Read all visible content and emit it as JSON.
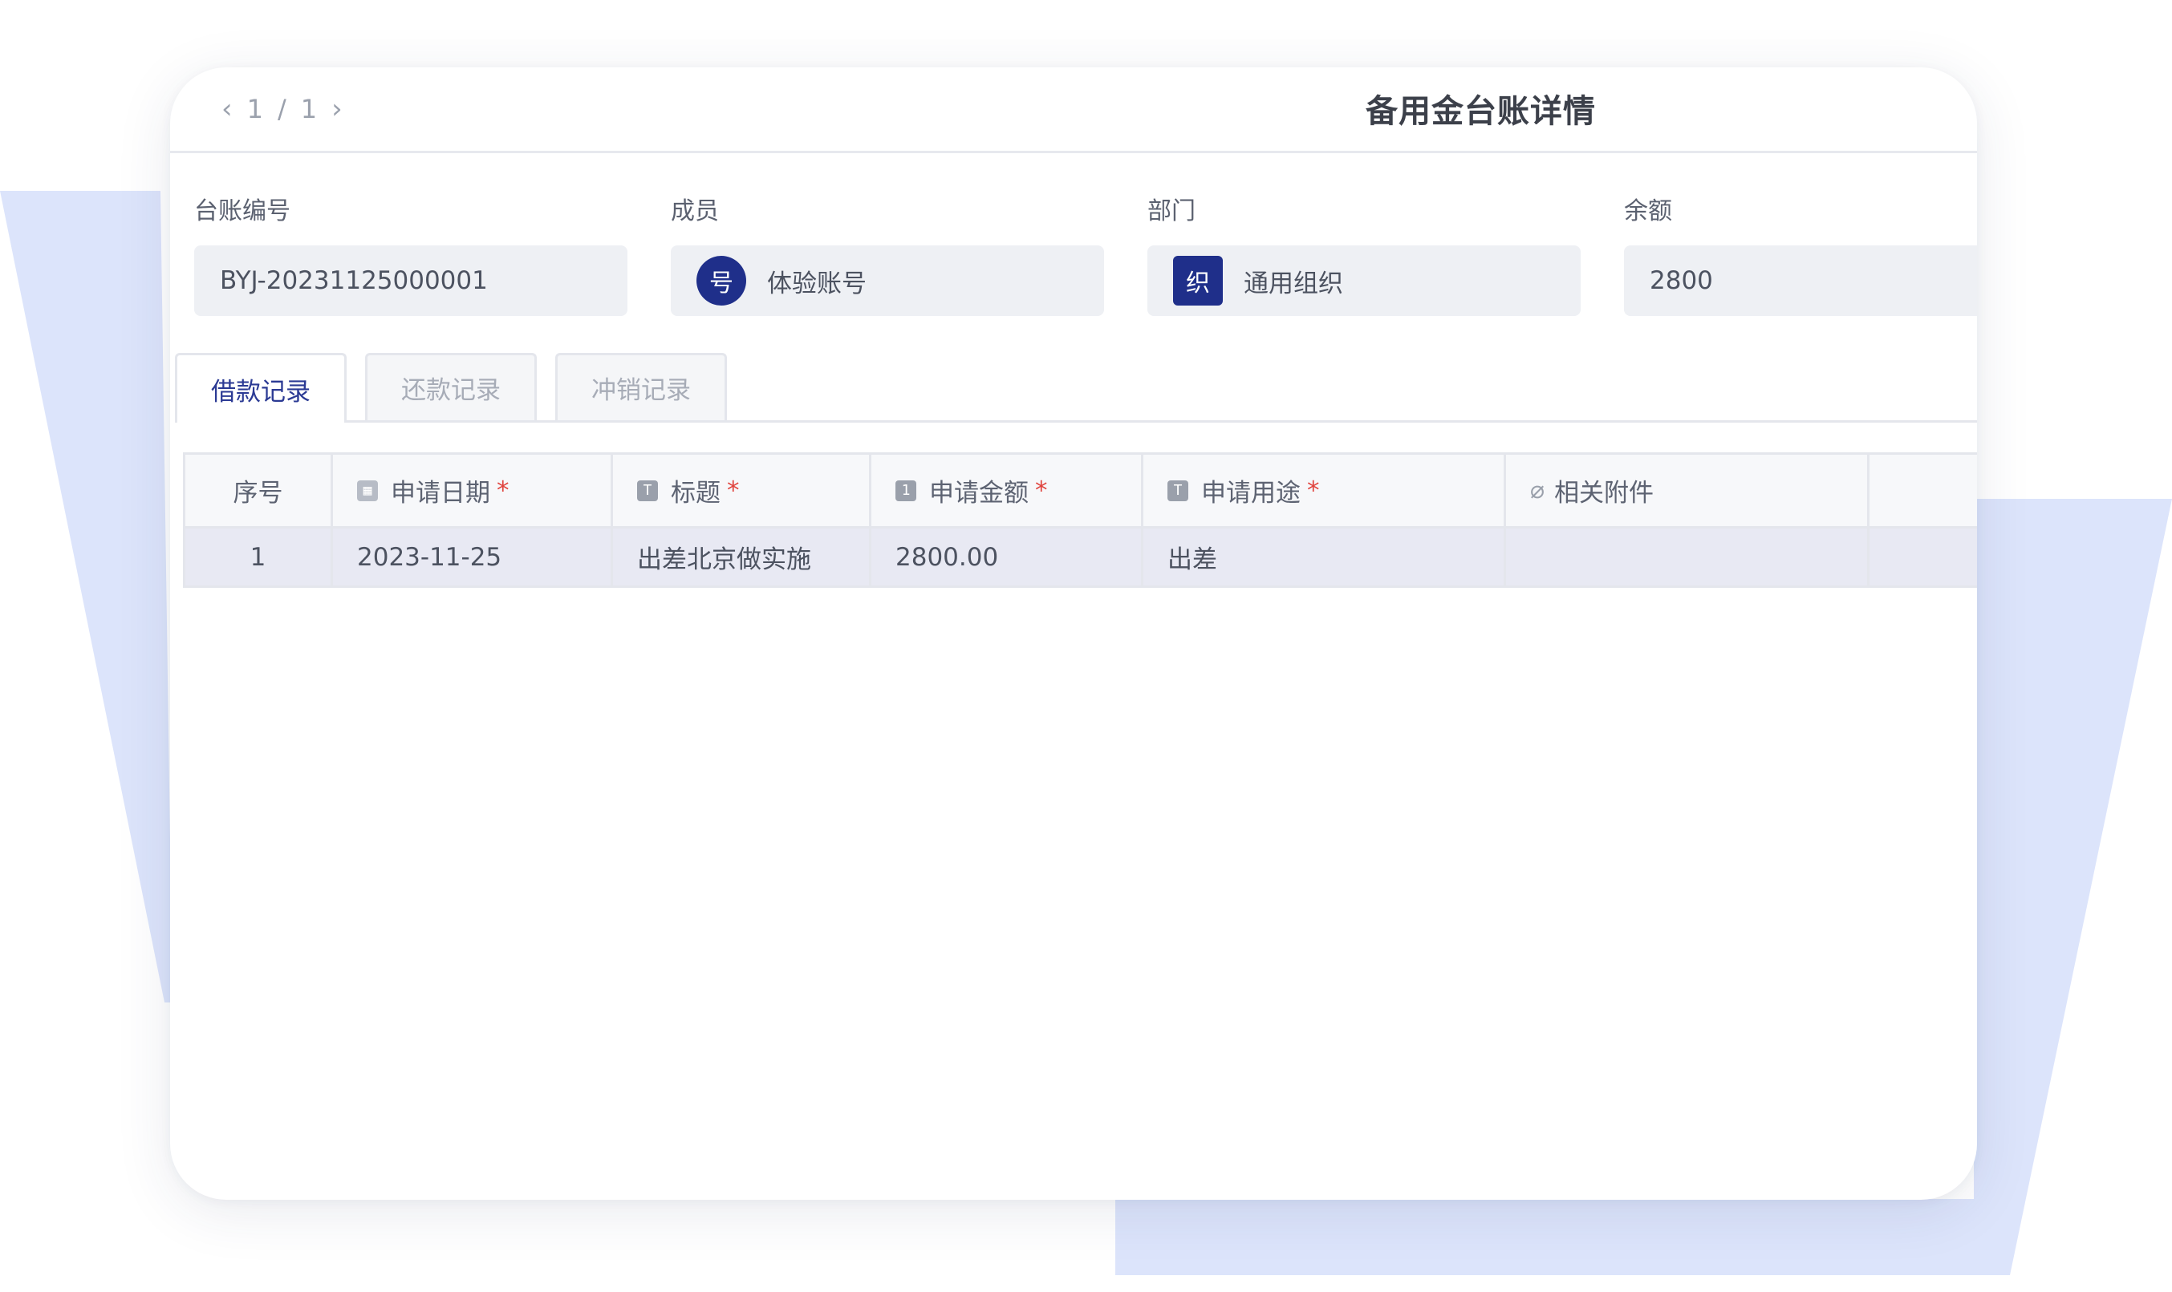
{
  "window": {
    "title": "备用金台账详情",
    "pager": {
      "current": "1",
      "separator": "/",
      "total": "1"
    }
  },
  "fields": [
    {
      "label": "台账编号",
      "value": "BYJ-20231125000001"
    },
    {
      "label": "成员",
      "avatar_text": "号",
      "value": "体验账号"
    },
    {
      "label": "部门",
      "avatar_text": "织",
      "value": "通用组织"
    },
    {
      "label": "余额",
      "value": "2800"
    }
  ],
  "tabs": [
    {
      "label": "借款记录",
      "active": true
    },
    {
      "label": "还款记录",
      "active": false
    },
    {
      "label": "冲销记录",
      "active": false
    }
  ],
  "table": {
    "columns": [
      {
        "label": "序号",
        "icon": "",
        "required": false
      },
      {
        "label": "申请日期",
        "icon": "calendar-icon",
        "required": true
      },
      {
        "label": "标题",
        "icon": "text-field-icon",
        "required": true
      },
      {
        "label": "申请金额",
        "icon": "number-field-icon",
        "required": true
      },
      {
        "label": "申请用途",
        "icon": "text-field-icon",
        "required": true
      },
      {
        "label": "相关附件",
        "icon": "paperclip-icon",
        "required": false
      }
    ],
    "required_mark": "*",
    "rows": [
      [
        "1",
        "2023-11-25",
        "出差北京做实施",
        "2800.00",
        "出差",
        ""
      ]
    ]
  },
  "colors": {
    "accent": "#2b3a94",
    "avatar_bg": "#1f2f8a",
    "background_shape": "#dce4fb",
    "required": "#e0443e",
    "row_highlight": "#e8e9f3"
  }
}
